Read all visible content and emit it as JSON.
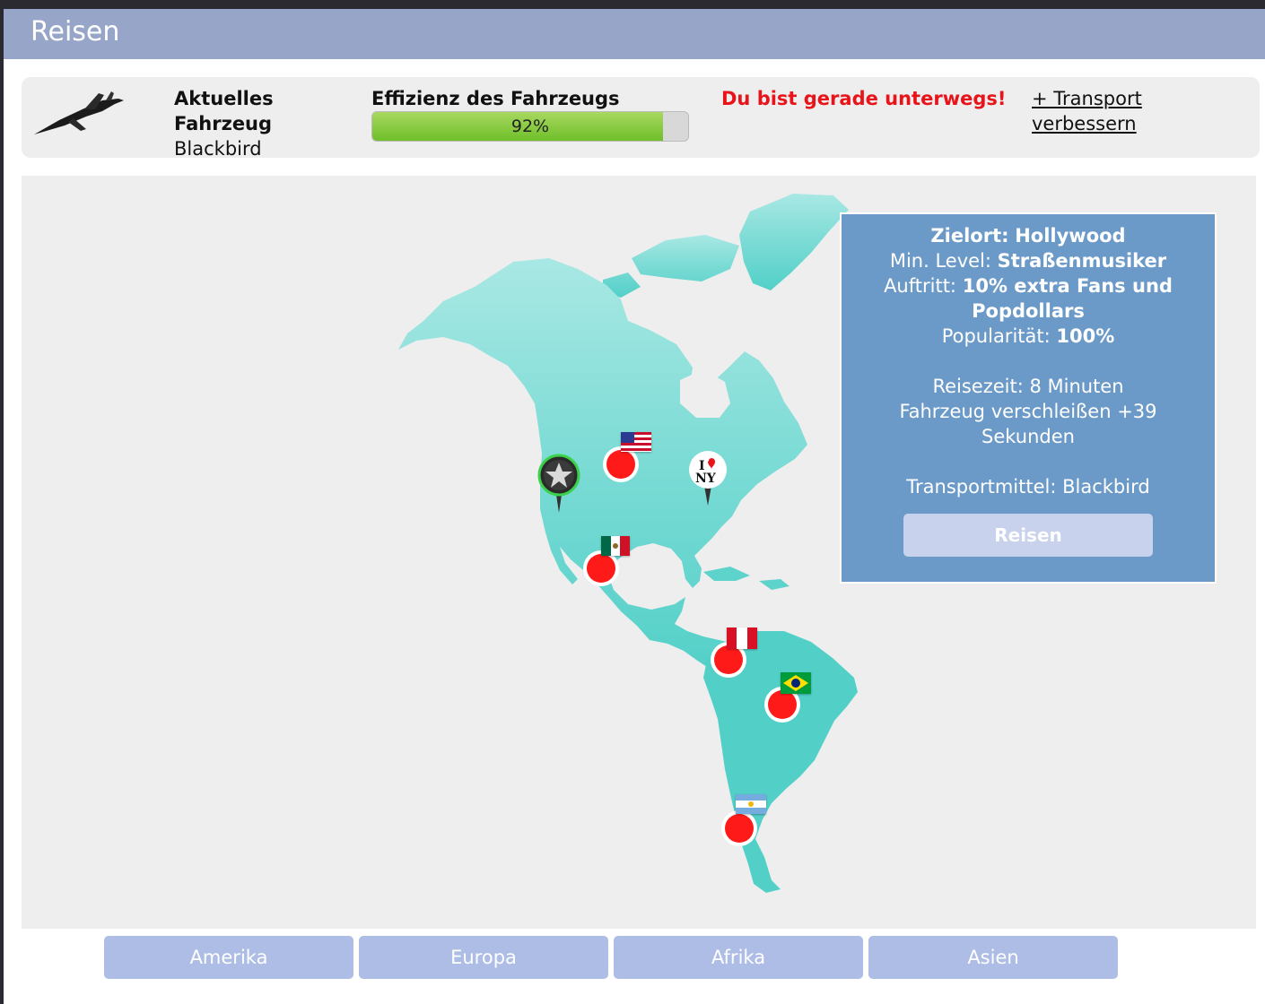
{
  "window": {
    "title": "Reisen"
  },
  "vehicle": {
    "label": "Aktuelles Fahrzeug",
    "name": "Blackbird"
  },
  "efficiency": {
    "label": "Effizienz des Fahrzeugs",
    "value_text": "92%",
    "value": 0.92
  },
  "status": {
    "message": "Du bist gerade unterwegs!"
  },
  "upgrade": {
    "label": "+ Transport verbessern"
  },
  "destination": {
    "heading_label": "Zielort:",
    "heading_value": "Hollywood",
    "min_level_label": "Min. Level:",
    "min_level_value": "Straßenmusiker",
    "gig_label": "Auftritt:",
    "gig_value": "10% extra Fans und Popdollars",
    "popularity_label": "Popularität:",
    "popularity_value": "100%",
    "travel_time": "Reisezeit: 8 Minuten",
    "wear": "Fahrzeug verschleißen +39 Sekunden",
    "transport": "Transportmittel: Blackbird",
    "button_label": "Reisen"
  },
  "map_pins": [
    {
      "name": "Hollywood",
      "type": "star"
    },
    {
      "name": "USA",
      "type": "flag"
    },
    {
      "name": "New York",
      "type": "i-love-ny",
      "text_top": "I",
      "text_bottom": "NY"
    },
    {
      "name": "Mexiko",
      "type": "flag"
    },
    {
      "name": "Peru",
      "type": "flag"
    },
    {
      "name": "Brasilien",
      "type": "flag"
    },
    {
      "name": "Argentinien",
      "type": "flag"
    }
  ],
  "tabs": [
    {
      "label": "Amerika"
    },
    {
      "label": "Europa"
    },
    {
      "label": "Afrika"
    },
    {
      "label": "Asien"
    }
  ],
  "colors": {
    "titlebar": "#97a5c9",
    "land": "#5dd3cc",
    "panel": "#6b9ac8",
    "alert": "#e8141a",
    "progress": "#7ec63a",
    "tab": "#aebde6",
    "pin_red": "#ff1a1a"
  }
}
